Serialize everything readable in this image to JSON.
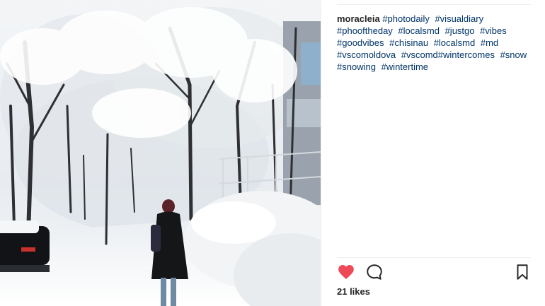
{
  "post": {
    "username": "moracleia",
    "hashtags": [
      "#photodaily",
      "#visualdiary",
      "#phooftheday",
      "#localsmd",
      "#justgo",
      "#vibes",
      "#goodvibes",
      "#chisinau",
      "#localsmd",
      "#md",
      "#vscomoldova",
      "#vscomd#wintercomes",
      "#snow",
      "#snowing",
      "#wintertime"
    ],
    "likes": "21 likes",
    "liked": true
  },
  "icons": {
    "like": "heart-icon",
    "comment": "comment-icon",
    "save": "bookmark-icon"
  },
  "colors": {
    "hashtag": "#003569",
    "heart": "#ed4956",
    "text": "#262626"
  }
}
